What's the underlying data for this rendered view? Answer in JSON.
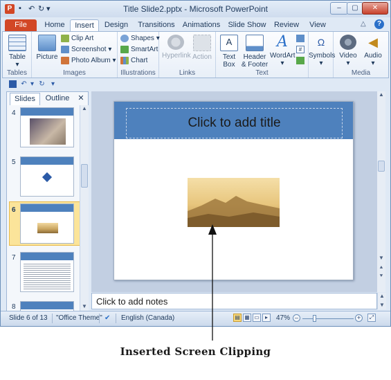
{
  "window": {
    "title": "Title Slide2.pptx - Microsoft PowerPoint",
    "app_icon_letter": "P",
    "controls": {
      "minimize": "–",
      "maximize": "▢",
      "close": "✕"
    }
  },
  "quick_access": {
    "save": "💾",
    "undo": "↶",
    "redo": "↻",
    "customize": "▾"
  },
  "tabs": {
    "file": "File",
    "home": "Home",
    "insert": "Insert",
    "design": "Design",
    "transitions": "Transitions",
    "animations": "Animations",
    "slide_show": "Slide Show",
    "review": "Review",
    "view": "View",
    "help": "?"
  },
  "ribbon": {
    "tables": {
      "group": "Tables",
      "table": "Table"
    },
    "images": {
      "group": "Images",
      "picture": "Picture",
      "clip_art": "Clip Art",
      "screenshot": "Screenshot",
      "photo_album": "Photo Album"
    },
    "illustrations": {
      "group": "Illustrations",
      "shapes": "Shapes",
      "smartart": "SmartArt",
      "chart": "Chart"
    },
    "links": {
      "group": "Links",
      "hyperlink": "Hyperlink",
      "action": "Action"
    },
    "text": {
      "group": "Text",
      "text_box_1": "Text",
      "text_box_2": "Box",
      "header_footer_1": "Header",
      "header_footer_2": "& Footer",
      "wordart": "WordArt"
    },
    "symbols": {
      "symbols": "Symbols"
    },
    "media": {
      "group": "Media",
      "video": "Video",
      "audio": "Audio"
    }
  },
  "panel": {
    "tab_slides": "Slides",
    "tab_outline": "Outline",
    "close": "✕",
    "thumbnails": [
      {
        "num": "4"
      },
      {
        "num": "5"
      },
      {
        "num": "6"
      },
      {
        "num": "7"
      },
      {
        "num": "8"
      }
    ],
    "selected": "6"
  },
  "slide": {
    "title_placeholder": "Click to add title"
  },
  "notes": {
    "placeholder": "Click to add notes"
  },
  "status": {
    "slide_info": "Slide 6 of 13",
    "theme": "\"Office Theme\"",
    "language": "English (Canada)",
    "zoom": "47%",
    "zoom_level": 0.47
  },
  "caption": "Inserted Screen Clipping",
  "colors": {
    "accent": "#4e81bd",
    "file_tab": "#d24726",
    "selection": "#fbe49a"
  }
}
